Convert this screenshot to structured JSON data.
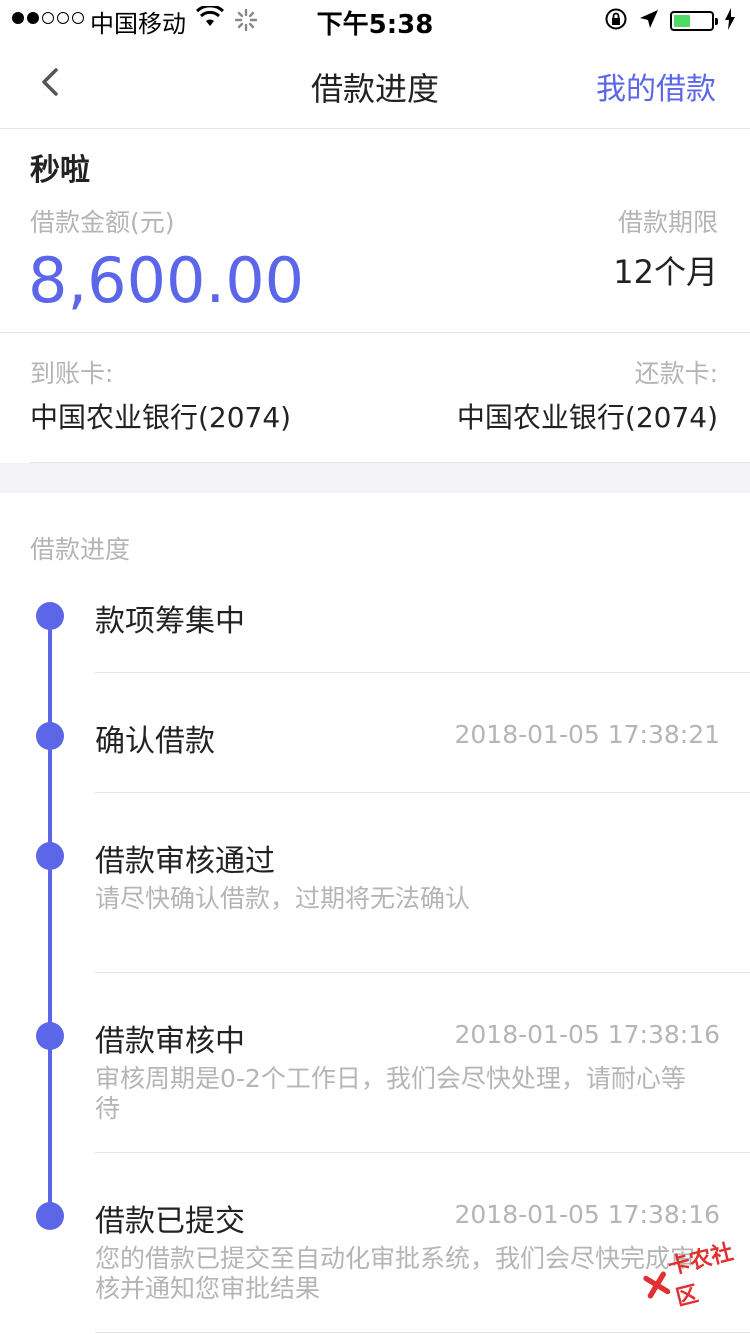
{
  "status_bar": {
    "carrier": "中国移动",
    "time": "下午5:38",
    "battery_level": 0.45
  },
  "nav": {
    "title": "借款进度",
    "right_action": "我的借款"
  },
  "summary": {
    "product_name": "秒啦",
    "amount_label": "借款金额(元)",
    "amount": "8,600.00",
    "term_label": "借款期限",
    "term": "12个月",
    "receive_card_label": "到账卡:",
    "receive_card": "中国农业银行(2074)",
    "repay_card_label": "还款卡:",
    "repay_card": "中国农业银行(2074)"
  },
  "progress": {
    "title": "借款进度",
    "steps": [
      {
        "title": "款项筹集中",
        "time": "",
        "desc": ""
      },
      {
        "title": "确认借款",
        "time": "2018-01-05 17:38:21",
        "desc": ""
      },
      {
        "title": "借款审核通过",
        "time": "",
        "desc": "请尽快确认借款，过期将无法确认"
      },
      {
        "title": "借款审核中",
        "time": "2018-01-05 17:38:16",
        "desc": "审核周期是0-2个工作日，我们会尽快处理，请耐心等待"
      },
      {
        "title": "借款已提交",
        "time": "2018-01-05 17:38:16",
        "desc": "您的借款已提交至自动化审批系统，我们会尽快完成审核并通知您审批结果"
      }
    ]
  },
  "watermark": {
    "text": "卡农社区"
  },
  "colors": {
    "accent": "#5b67e8",
    "muted": "#b5b5b5",
    "text": "#222222"
  }
}
